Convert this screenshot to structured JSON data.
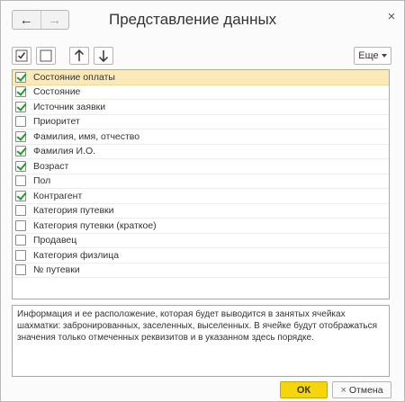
{
  "window": {
    "title": "Представление данных"
  },
  "nav": {
    "back_icon": "←",
    "forward_icon": "→"
  },
  "close_icon": "×",
  "toolbar": {
    "more_label": "Еще"
  },
  "items": [
    {
      "label": "Состояние оплаты",
      "checked": true,
      "selected": true
    },
    {
      "label": "Состояние",
      "checked": true
    },
    {
      "label": "Источник заявки",
      "checked": true
    },
    {
      "label": "Приоритет",
      "checked": false
    },
    {
      "label": "Фамилия, имя, отчество",
      "checked": true
    },
    {
      "label": "Фамилия И.О.",
      "checked": true
    },
    {
      "label": "Возраст",
      "checked": true
    },
    {
      "label": "Пол",
      "checked": false
    },
    {
      "label": "Контрагент",
      "checked": true
    },
    {
      "label": "Категория путевки",
      "checked": false
    },
    {
      "label": "Категория путевки (краткое)",
      "checked": false
    },
    {
      "label": "Продавец",
      "checked": false
    },
    {
      "label": "Категория физлица",
      "checked": false
    },
    {
      "label": "№ путевки",
      "checked": false
    }
  ],
  "info_text": "Информация и ее расположение, которая будет выводится в занятых ячейках шахматки: забронированных, заселенных, выселенных. В ячейке будут отображаться значения только отмеченных реквизитов и в указанном здесь порядке.",
  "footer": {
    "ok_label": "ОК",
    "cancel_label": "Отмена",
    "cancel_icon": "×"
  }
}
